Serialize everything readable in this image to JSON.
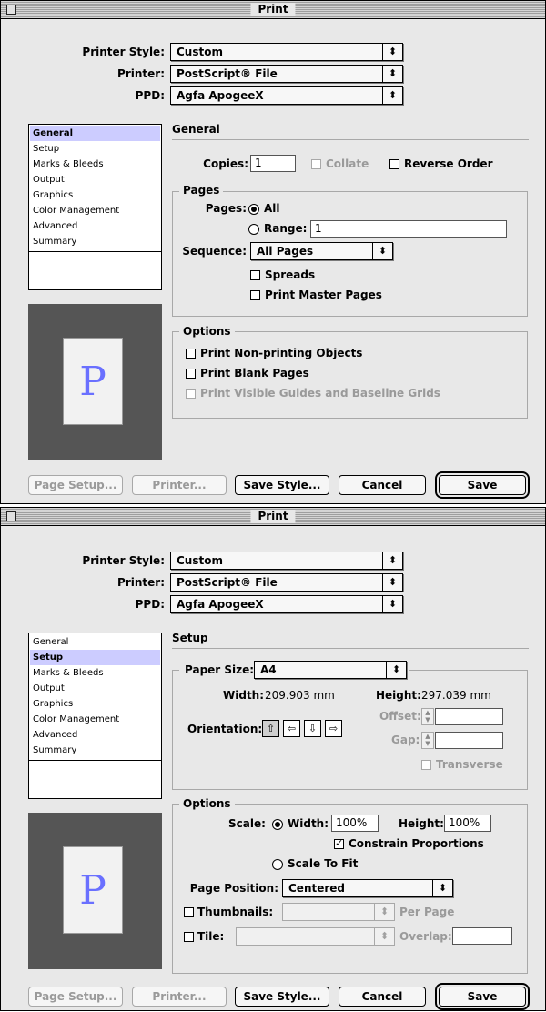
{
  "dialog1": {
    "title": "Print",
    "printer_style": {
      "label": "Printer Style:",
      "value": "Custom"
    },
    "printer": {
      "label": "Printer:",
      "value": "PostScript® File"
    },
    "ppd": {
      "label": "PPD:",
      "value": "Agfa ApogeeX"
    },
    "sidebar": {
      "items": [
        "General",
        "Setup",
        "Marks & Bleeds",
        "Output",
        "Graphics",
        "Color Management",
        "Advanced",
        "Summary"
      ],
      "selected": "General"
    },
    "preview": {
      "letter": "P"
    },
    "section_title": "General",
    "copies": {
      "label": "Copies:",
      "value": "1"
    },
    "collate": {
      "label": "Collate",
      "checked": false,
      "enabled": false
    },
    "reverse_order": {
      "label": "Reverse Order",
      "checked": false
    },
    "pages_group": {
      "title": "Pages",
      "pages_label": "Pages:",
      "all_label": "All",
      "range_label": "Range:",
      "range_value": "1",
      "sequence_label": "Sequence:",
      "sequence_value": "All Pages",
      "spreads_label": "Spreads",
      "master_pages_label": "Print Master Pages"
    },
    "options_group": {
      "title": "Options",
      "non_printing": "Print Non-printing Objects",
      "blank_pages": "Print Blank Pages",
      "visible_guides": "Print Visible Guides and Baseline Grids"
    },
    "buttons": {
      "page_setup": "Page Setup...",
      "printer": "Printer...",
      "save_style": "Save Style...",
      "cancel": "Cancel",
      "save": "Save"
    }
  },
  "dialog2": {
    "title": "Print",
    "printer_style": {
      "label": "Printer Style:",
      "value": "Custom"
    },
    "printer": {
      "label": "Printer:",
      "value": "PostScript® File"
    },
    "ppd": {
      "label": "PPD:",
      "value": "Agfa ApogeeX"
    },
    "sidebar": {
      "items": [
        "General",
        "Setup",
        "Marks & Bleeds",
        "Output",
        "Graphics",
        "Color Management",
        "Advanced",
        "Summary"
      ],
      "selected": "Setup"
    },
    "preview": {
      "letter": "P"
    },
    "section_title": "Setup",
    "paper_group": {
      "paper_size_label": "Paper Size:",
      "paper_size_value": "A4",
      "width_label": "Width:",
      "width_value": "209.903 mm",
      "height_label": "Height:",
      "height_value": "297.039 mm",
      "orientation_label": "Orientation:",
      "offset_label": "Offset:",
      "gap_label": "Gap:",
      "transverse_label": "Transverse"
    },
    "options_group": {
      "title": "Options",
      "scale_label": "Scale:",
      "width_label": "Width:",
      "width_value": "100%",
      "height_label": "Height:",
      "height_value": "100%",
      "constrain_label": "Constrain Proportions",
      "scale_to_fit_label": "Scale To Fit",
      "page_position_label": "Page Position:",
      "page_position_value": "Centered",
      "thumbnails_label": "Thumbnails:",
      "per_page_label": "Per Page",
      "tile_label": "Tile:",
      "overlap_label": "Overlap:"
    },
    "buttons": {
      "page_setup": "Page Setup...",
      "printer": "Printer...",
      "save_style": "Save Style...",
      "cancel": "Cancel",
      "save": "Save"
    }
  }
}
